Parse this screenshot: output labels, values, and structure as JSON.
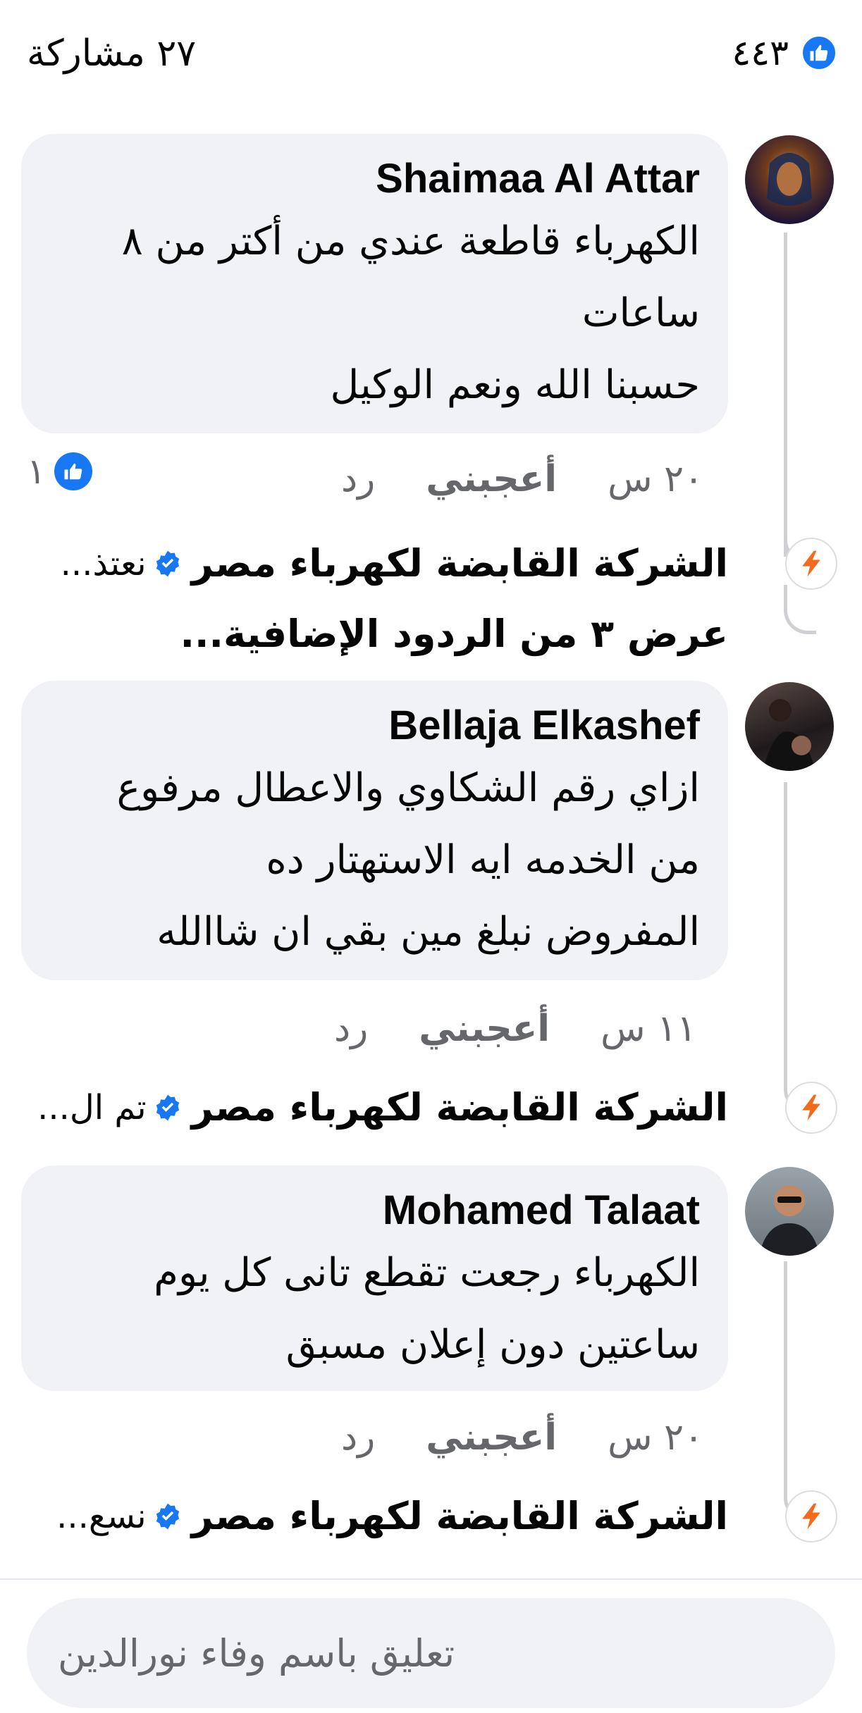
{
  "post_stats": {
    "reactions_count": "٤٤٣",
    "shares_label": "٢٧ مشاركة",
    "like_color": "#1877f2"
  },
  "comments": [
    {
      "author": "Shaimaa Al Attar",
      "lines": [
        "الكهرباء قاطعة عندي من أكتر من ٨",
        "ساعات",
        "حسبنا الله ونعم الوكيل"
      ],
      "time": "٢٠ س",
      "like_label": "أعجبني",
      "reply_label": "رد",
      "reaction_count": "١",
      "reply_preview": {
        "name": "الشركة القابضة لكهرباء مصر",
        "snippet": "نعتذ..."
      },
      "more_replies": "عرض ٣ من الردود الإضافية..."
    },
    {
      "author": "Bellaja Elkashef",
      "lines": [
        "ازاي رقم الشكاوي والاعطال مرفوع",
        "من الخدمه ايه الاستهتار ده",
        "المفروض نبلغ مين بقي ان شاالله"
      ],
      "time": "١١ س",
      "like_label": "أعجبني",
      "reply_label": "رد",
      "reply_preview": {
        "name": "الشركة القابضة لكهرباء مصر",
        "snippet": "تم ال..."
      }
    },
    {
      "author": "Mohamed Talaat",
      "lines": [
        "الكهرباء رجعت تقطع تانى كل يوم",
        "ساعتين دون إعلان مسبق"
      ],
      "time": "٢٠ س",
      "like_label": "أعجبني",
      "reply_label": "رد",
      "reply_preview": {
        "name": "الشركة القابضة لكهرباء مصر",
        "snippet": "نسع..."
      }
    }
  ],
  "composer": {
    "placeholder": "تعليق باسم وفاء نورالدين"
  }
}
